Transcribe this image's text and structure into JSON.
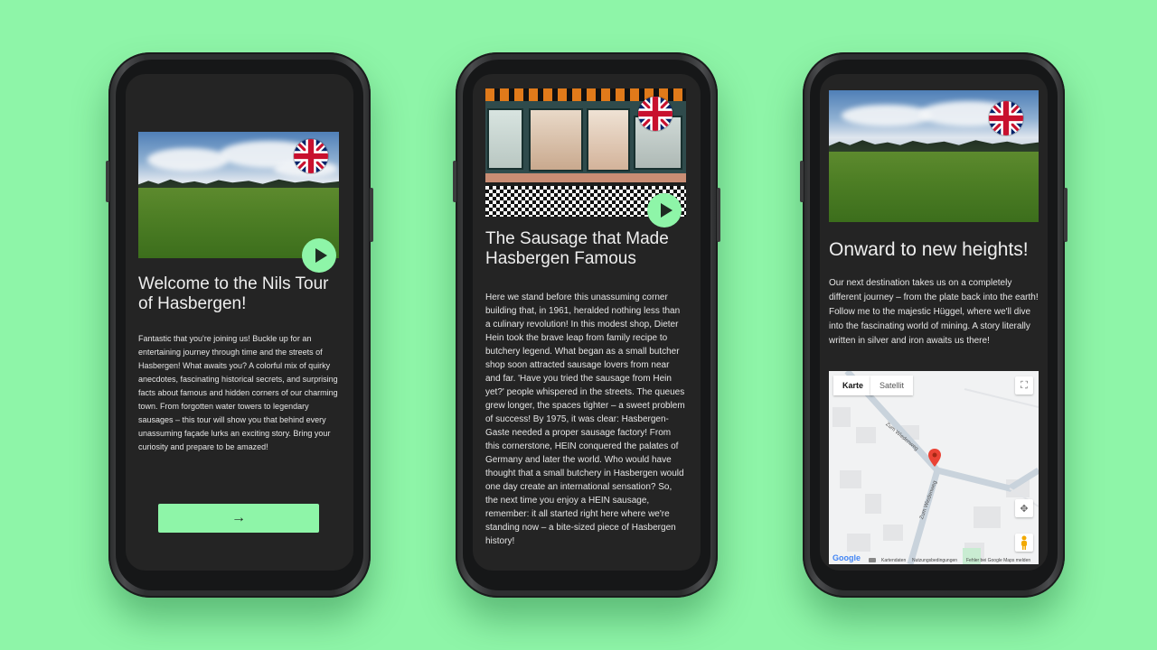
{
  "background_color": "#8ef5a8",
  "accent_color": "#8ef5a8",
  "screens": [
    {
      "title": "Welcome to the Nils Tour of Hasbergen!",
      "body": "Fantastic that you're joining us! Buckle up for an entertaining journey through time and the streets of Hasbergen! What awaits you? A colorful mix of quirky anecdotes, fascinating historical secrets, and surprising facts about famous and hidden corners of our charming town. From forgotten water towers to legendary sausages – this tour will show you that behind every unassuming façade lurks an exciting story. Bring your curiosity and prepare to be amazed!",
      "next_label": "→",
      "language_icon": "uk-flag-icon",
      "play_icon": "play-icon"
    },
    {
      "title": "The Sausage that Made Hasbergen Famous",
      "body": "Here we stand before this unassuming corner building that, in 1961, heralded nothing less than a culinary revolution! In this modest shop, Dieter Hein took the brave leap from family recipe to butchery legend. What began as a small butcher shop soon attracted sausage lovers from near and far. 'Have you tried the sausage from Hein yet?' people whispered in the streets. The queues grew longer, the spaces tighter – a sweet problem of success! By 1975, it was clear: Hasbergen-Gaste needed a proper sausage factory! From this cornerstone, HEIN conquered the palates of Germany and later the world. Who would have thought that a small butchery in Hasbergen would one day create an international sensation? So, the next time you enjoy a HEIN sausage, remember: it all started right here where we're standing now – a bite-sized piece of Hasbergen history!",
      "language_icon": "uk-flag-icon",
      "play_icon": "play-icon"
    },
    {
      "title": "Onward to new heights!",
      "body": "Our next destination takes us on a completely different journey – from the plate back into the earth! Follow me to the majestic Hüggel, where we'll dive into the fascinating world of mining. A story literally written in silver and iron awaits us there!",
      "language_icon": "uk-flag-icon",
      "map": {
        "tab_map": "Karte",
        "tab_satellite": "Satellit",
        "street_1": "Zum Wiedenweg",
        "street_2": "Zum Wiedenweg",
        "logo": "Google",
        "footer_data": "Kartendaten",
        "footer_terms": "Nutzungsbedingungen",
        "footer_report": "Fehler bei Google Maps melden"
      }
    }
  ]
}
